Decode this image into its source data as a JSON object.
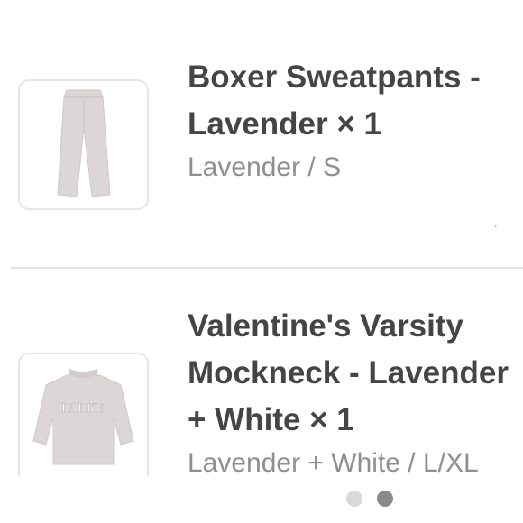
{
  "items": [
    {
      "title_lines": [
        "Boxer Sweatpants -",
        "Lavender × 1"
      ],
      "variant": "Lavender / S",
      "image_icon": "sweatpants-image"
    },
    {
      "title_lines": [
        "Valentine's Varsity",
        "Mockneck - Lavender",
        "+ White × 1"
      ],
      "variant": "Lavender + White / L/XL",
      "image_icon": "sweater-image",
      "image_text": "PARKE"
    }
  ],
  "stray_mark": ",",
  "pager": {
    "count": 2,
    "active_index": 1
  },
  "colors": {
    "title": "#454545",
    "variant": "#8f8f8f",
    "divider": "#e4e4e4",
    "dot_inactive": "#d9d9d9",
    "dot_active": "#8a8a8a",
    "garment": "#dcd6d6"
  }
}
